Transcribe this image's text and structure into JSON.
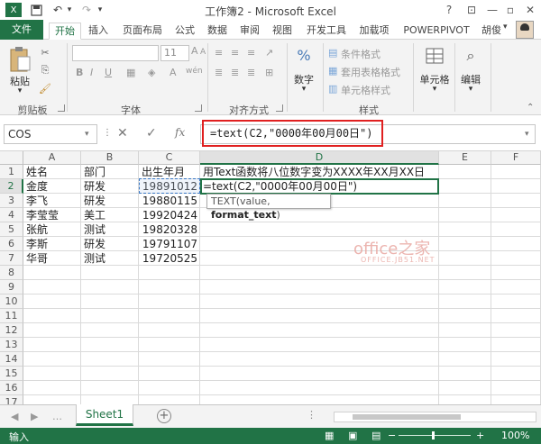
{
  "window": {
    "title": "工作簿2 - Microsoft Excel",
    "help": "?",
    "minimize": "—",
    "restore": "▫",
    "close": "✕"
  },
  "quick_access": {
    "save": "💾",
    "undo": "↶",
    "redo": "↷",
    "customize": "▾"
  },
  "ribbon_tabs": [
    "文件",
    "开始",
    "插入",
    "页面布局",
    "公式",
    "数据",
    "审阅",
    "视图",
    "开发工具",
    "加载项",
    "POWERPIVOT"
  ],
  "user": "胡俊",
  "ribbon": {
    "clipboard": {
      "paste": "粘贴",
      "label": "剪贴板"
    },
    "font": {
      "size": "11",
      "label": "字体",
      "bold": "B",
      "italic": "I",
      "underline": "U",
      "grow": "A",
      "shrink": "A",
      "fontcolor": "A",
      "phonetic": "wén"
    },
    "alignment": {
      "label": "对齐方式"
    },
    "number": {
      "btn": "数字",
      "pct": "%",
      "label": ""
    },
    "styles": {
      "conditional": "条件格式",
      "table": "套用表格格式",
      "cell": "单元格样式",
      "label": "样式"
    },
    "cells": {
      "btn": "单元格"
    },
    "editing": {
      "btn": "编辑"
    }
  },
  "formula_bar": {
    "name_box": "COS",
    "cancel": "✕",
    "enter": "✓",
    "fx": "fx",
    "formula": "=text(C2,\"0000年00月00日\")"
  },
  "columns": [
    "A",
    "B",
    "C",
    "D",
    "E",
    "F"
  ],
  "rows": [
    "1",
    "2",
    "3",
    "4",
    "5",
    "6",
    "7",
    "8",
    "9",
    "10",
    "11",
    "12",
    "13",
    "14",
    "15",
    "16",
    "17"
  ],
  "table": {
    "header": [
      "姓名",
      "部门",
      "出生年月",
      "用Text函数将八位数字变为XXXX年XX月XX日"
    ],
    "data": [
      [
        "金度",
        "研发",
        "19891012",
        "=text(C2,\"0000年00月00日\")"
      ],
      [
        "李飞",
        "研发",
        "19880115",
        ""
      ],
      [
        "李莹莹",
        "美工",
        "19920424",
        ""
      ],
      [
        "张航",
        "测试",
        "19820328",
        ""
      ],
      [
        "李斯",
        "研发",
        "19791107",
        ""
      ],
      [
        "华哥",
        "测试",
        "19720525",
        ""
      ]
    ]
  },
  "tooltip": {
    "pre": "TEXT(value, ",
    "bold": "format_text",
    "post": ")"
  },
  "watermark": {
    "main": "office之家",
    "sub": "OFFICE.JB51.NET"
  },
  "sheet_tabs": [
    "Sheet1"
  ],
  "add_sheet": "+",
  "status": {
    "mode": "输入",
    "zoom": "100%",
    "minus": "−",
    "plus": "+"
  }
}
